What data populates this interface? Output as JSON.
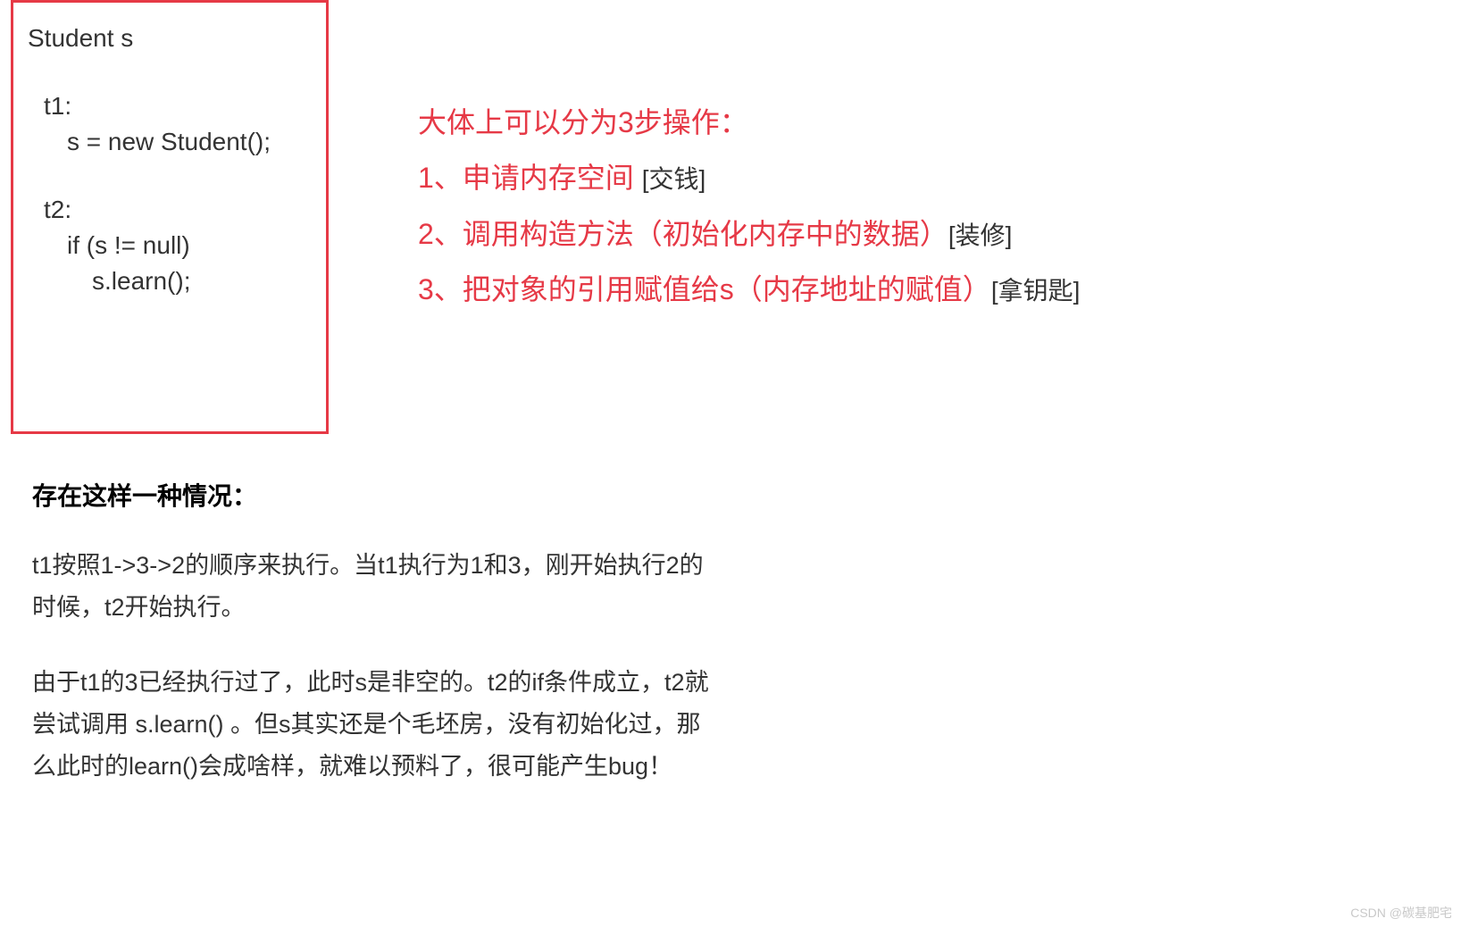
{
  "code": {
    "line1": "Student s",
    "line2": "t1:",
    "line3": "s = new Student();",
    "line4": "t2:",
    "line5": "if (s != null)",
    "line6": "s.learn();"
  },
  "steps": {
    "heading": "大体上可以分为3步操作：",
    "s1_red": "1、申请内存空间 ",
    "s1_dark": "[交钱]",
    "s2_red": "2、调用构造方法（初始化内存中的数据）",
    "s2_dark": "[装修]",
    "s3_red": "3、把对象的引用赋值给s（内存地址的赋值）",
    "s3_dark": "[拿钥匙]"
  },
  "explain": {
    "title": "存在这样一种情况：",
    "para1": "t1按照1->3->2的顺序来执行。当t1执行为1和3，刚开始执行2的时候，t2开始执行。",
    "para2": "由于t1的3已经执行过了，此时s是非空的。t2的if条件成立，t2就尝试调用 s.learn() 。但s其实还是个毛坯房，没有初始化过，那么此时的learn()会成啥样，就难以预料了，很可能产生bug！"
  },
  "watermark": "CSDN @碳基肥宅"
}
